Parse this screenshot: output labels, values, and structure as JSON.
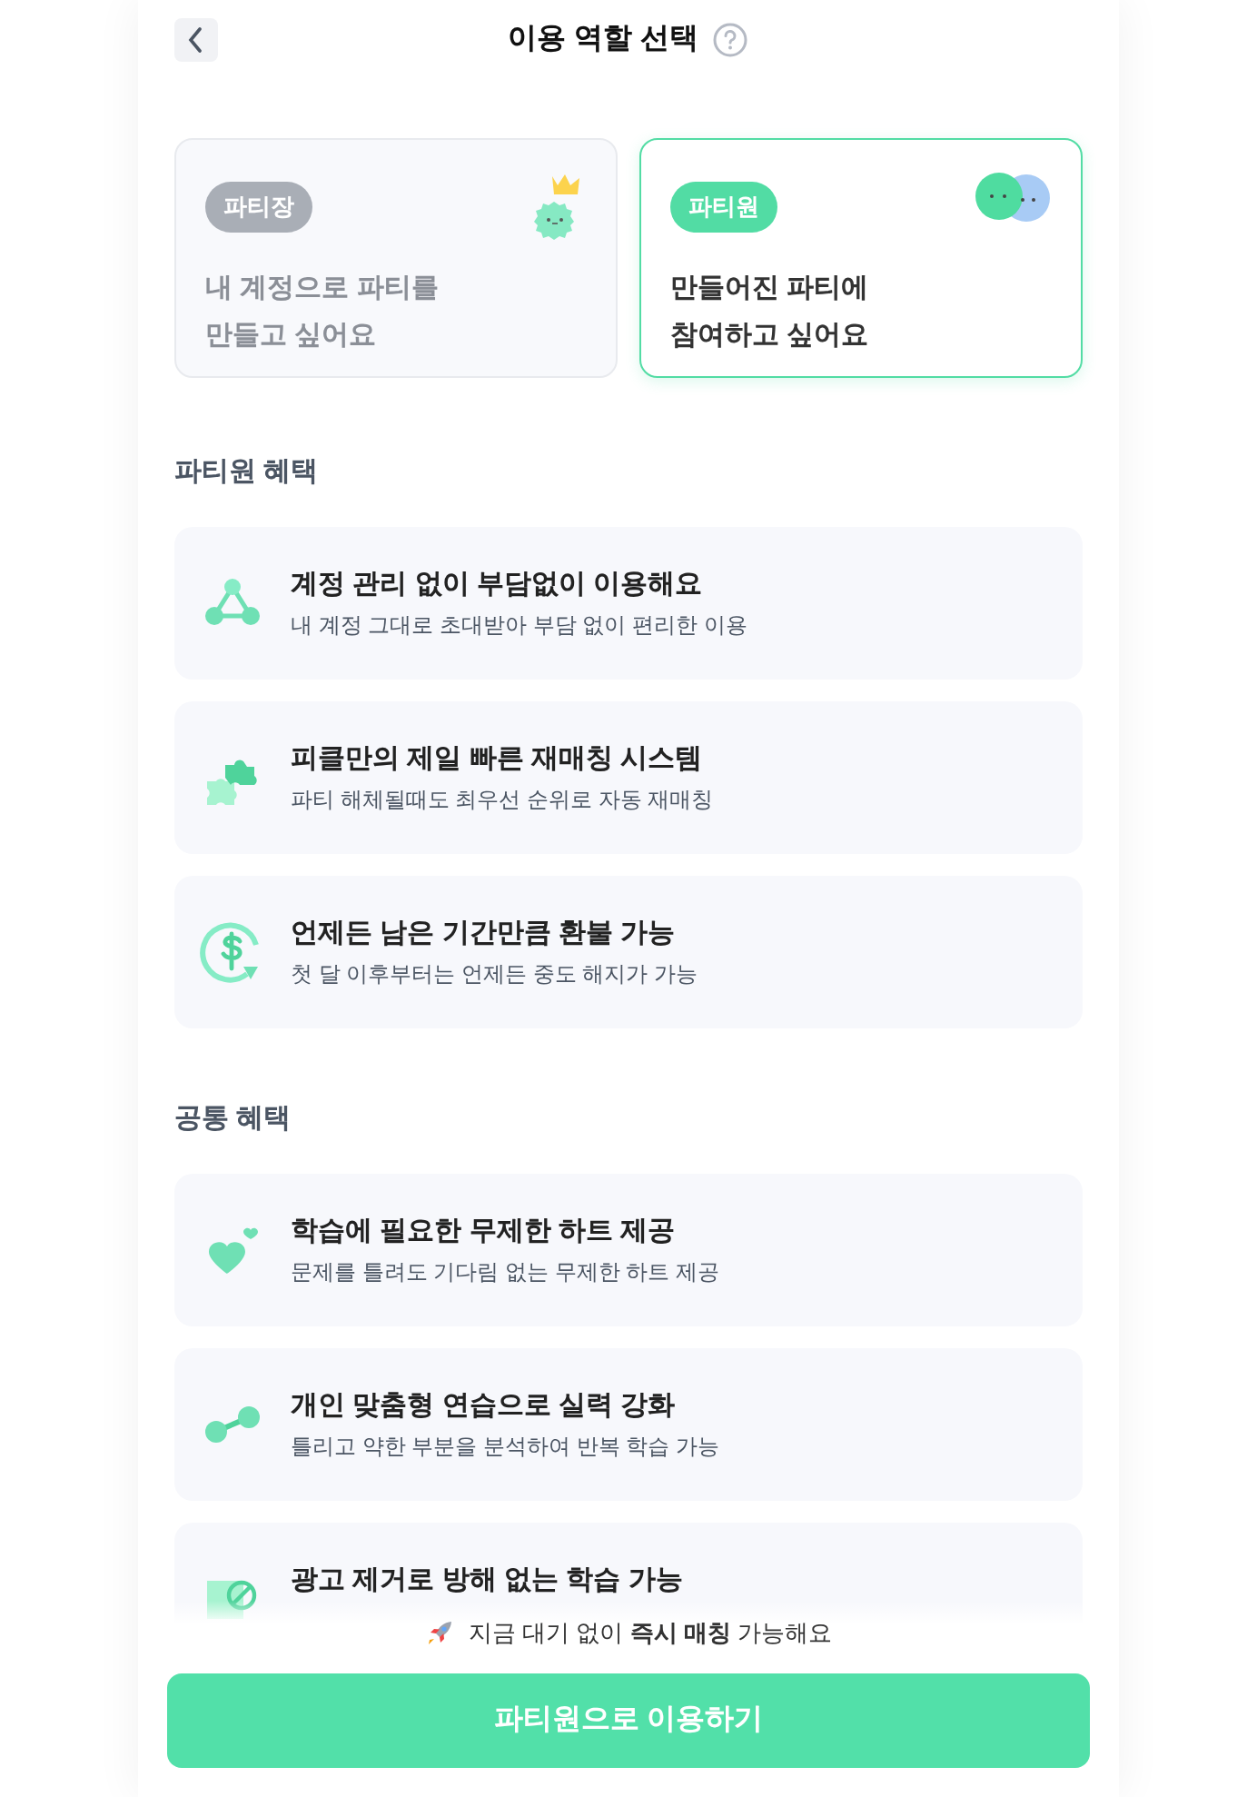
{
  "header": {
    "title": "이용 역할 선택"
  },
  "roles": [
    {
      "badge": "파티장",
      "description": [
        "내 계정으로 파티를",
        "만들고 싶어요"
      ],
      "selected": false,
      "kind": "leader"
    },
    {
      "badge": "파티원",
      "description": [
        "만들어진 파티에",
        "참여하고 싶어요"
      ],
      "selected": true,
      "kind": "member"
    }
  ],
  "sections": [
    {
      "title": "파티원 혜택",
      "benefits": [
        {
          "kind": "network",
          "title": "계정 관리 없이 부담없이 이용해요",
          "subtitle": "내 계정 그대로 초대받아 부담 없이 편리한 이용"
        },
        {
          "kind": "puzzle",
          "title": "피클만의 제일 빠른 재매칭 시스템",
          "subtitle": "파티 해체될때도 최우선 순위로 자동 재매칭"
        },
        {
          "kind": "refund",
          "title": "언제든 남은 기간만큼 환불 가능",
          "subtitle": "첫 달 이후부터는 언제든 중도 해지가 가능"
        }
      ]
    },
    {
      "title": "공통 혜택",
      "benefits": [
        {
          "kind": "heart",
          "title": "학습에 필요한 무제한 하트 제공",
          "subtitle": "문제를 틀려도 기다림 없는 무제한 하트 제공"
        },
        {
          "kind": "dumbbell",
          "title": "개인 맞춤형 연습으로 실력 강화",
          "subtitle": "틀리고 약한 부분을 분석하여 반복 학습 가능"
        },
        {
          "kind": "noads",
          "title": "광고 제거로 방해 없는 학습 가능"
        }
      ]
    }
  ],
  "footer": {
    "notice": "지금 대기 없이 **즉시 매칭** 가능해요",
    "button": "파티원으로 이용하기"
  }
}
